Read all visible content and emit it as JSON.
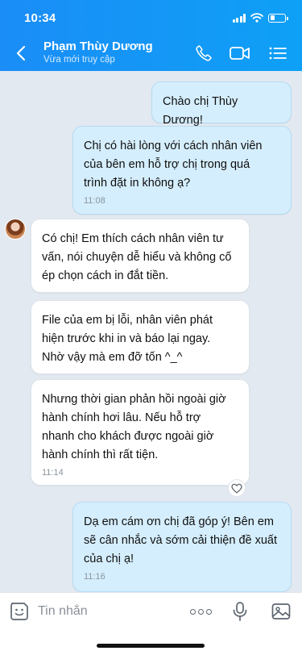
{
  "status_bar": {
    "time": "10:34"
  },
  "header": {
    "contact_name": "Phạm Thùy Dương",
    "contact_status": "Vừa mới truy cập"
  },
  "messages": [
    {
      "direction": "out",
      "text": "Chào chị Thùy Dương!",
      "time": ""
    },
    {
      "direction": "out",
      "text": "Chị có hài lòng với cách nhân viên\ncủa bên em hỗ trợ chị trong quá\ntrình đặt in không ạ?",
      "time": "11:08"
    },
    {
      "direction": "in",
      "text": "Có chị! Em thích cách nhân viên tư\nvấn, nói chuyện dễ hiểu và không cố\nép chọn cách in đắt tiền.",
      "time": ""
    },
    {
      "direction": "in",
      "text": "File của em bị lỗi, nhân viên phát\nhiện trước khi in và báo lại ngay.\nNhờ vậy mà em đỡ tốn ^_^",
      "time": ""
    },
    {
      "direction": "in",
      "text": "Nhưng thời gian phản hồi ngoài giờ\nhành chính hơi lâu. Nếu hỗ trợ\nnhanh cho khách được ngoài giờ\nhành chính thì rất tiện.",
      "time": "11:14"
    },
    {
      "direction": "out",
      "text": "Dạ em cám ơn chị đã góp ý! Bên em\nsẽ cân nhắc và sớm cải thiện đề xuất\ncủa chị ạ!",
      "time": "11:16"
    }
  ],
  "input": {
    "placeholder": "Tin nhắn"
  },
  "colors": {
    "header_start": "#1a8df7",
    "header_end": "#0ea0f6",
    "outgoing_bubble": "#d5eefd",
    "incoming_bubble": "#ffffff",
    "chat_bg": "#e2e9f1"
  },
  "icons": {
    "back": "chevron-left-icon",
    "call": "phone-icon",
    "video": "video-camera-icon",
    "menu": "list-menu-icon",
    "sticker": "sticker-icon",
    "more": "more-dots-icon",
    "mic": "microphone-icon",
    "image": "image-icon",
    "react": "heart-icon"
  }
}
